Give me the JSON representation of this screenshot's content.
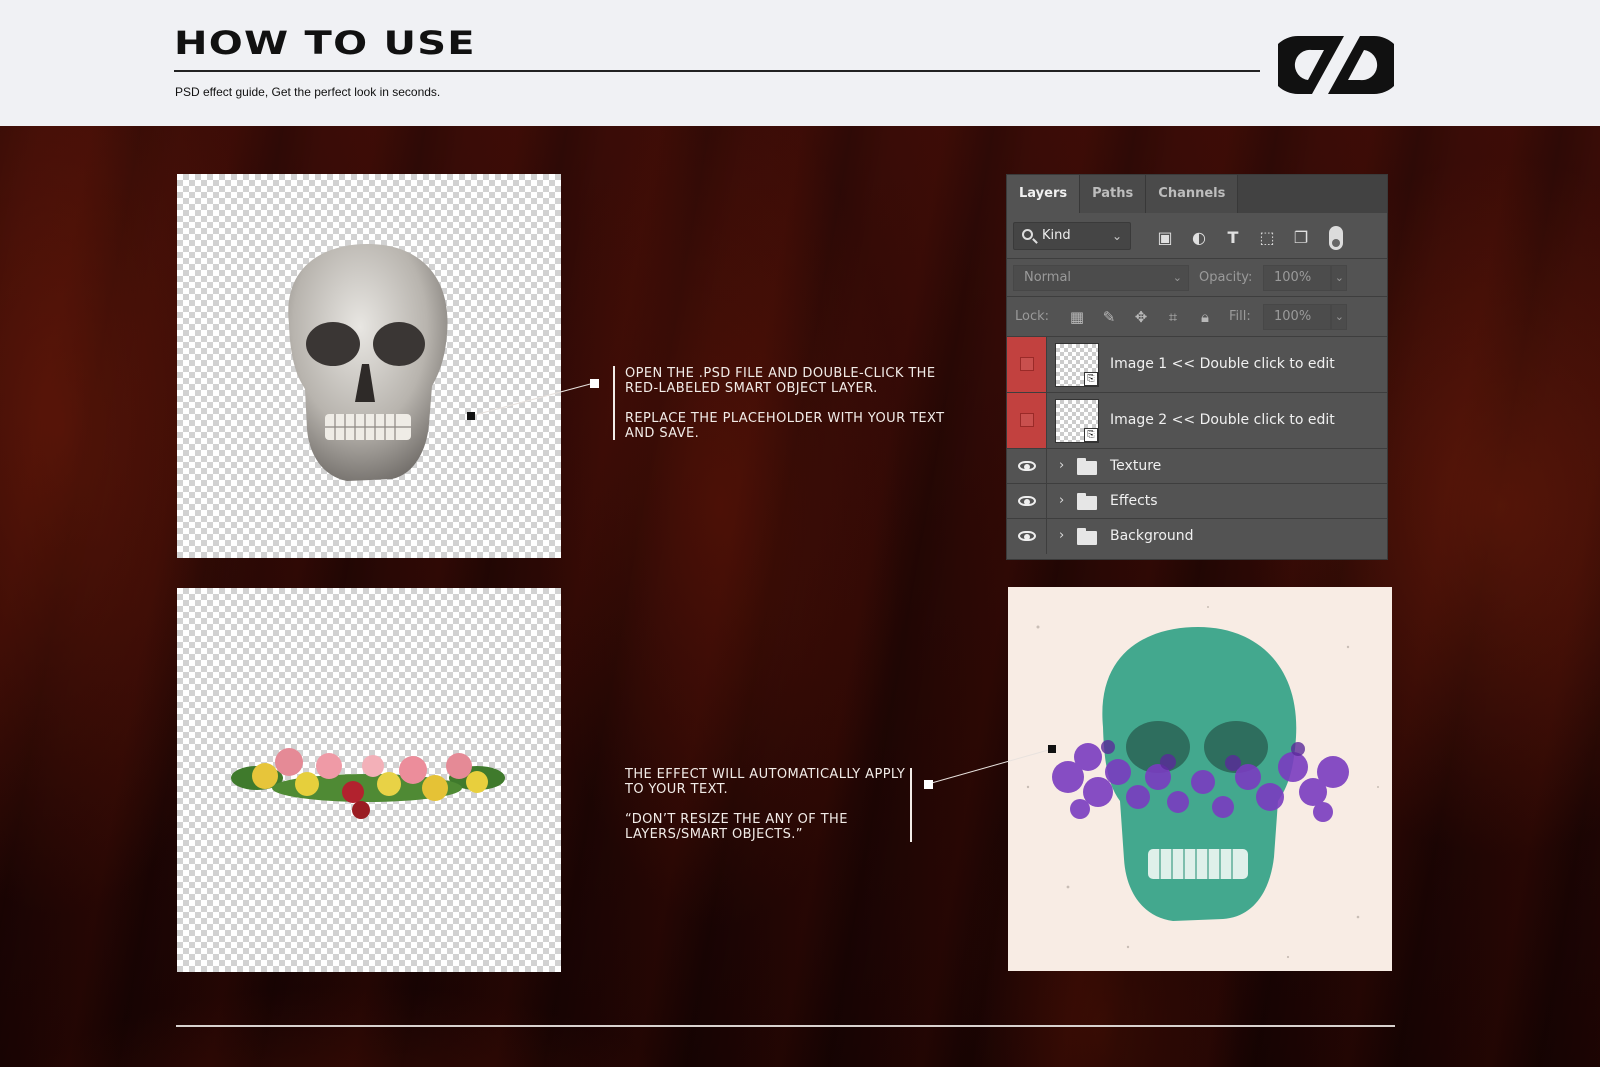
{
  "header": {
    "title": "HOW TO USE",
    "subtitle": "PSD effect guide, Get the perfect look in seconds."
  },
  "annotations": {
    "step1_line1": "OPEN THE .PSD FILE AND DOUBLE-CLICK THE RED-LABELED SMART OBJECT LAYER.",
    "step1_line2": "REPLACE THE PLACEHOLDER WITH YOUR TEXT AND SAVE.",
    "step2_line1": "THE EFFECT WILL AUTOMATICALLY APPLY TO YOUR TEXT.",
    "step2_line2": "“DON’T RESIZE THE ANY OF THE LAYERS/SMART OBJECTS.”"
  },
  "layers_panel": {
    "tabs": [
      "Layers",
      "Paths",
      "Channels"
    ],
    "active_tab": "Layers",
    "filter_kind": "Kind",
    "blend_mode": "Normal",
    "opacity_label": "Opacity:",
    "opacity_value": "100%",
    "lock_label": "Lock:",
    "fill_label": "Fill:",
    "fill_value": "100%",
    "layers": [
      {
        "name": "Image 1 << Double click to edit",
        "type": "smart-object",
        "label_color": "red"
      },
      {
        "name": "Image 2 << Double click to edit",
        "type": "smart-object",
        "label_color": "red"
      },
      {
        "name": "Texture",
        "type": "group",
        "visible": true
      },
      {
        "name": "Effects",
        "type": "group",
        "visible": true
      },
      {
        "name": "Background",
        "type": "group",
        "visible": true
      }
    ]
  },
  "colors": {
    "header_bg": "#f0f1f4",
    "accent_red": "#c2413f",
    "result_skull": "#3aa088",
    "result_flowers": "#7a3cc0"
  }
}
